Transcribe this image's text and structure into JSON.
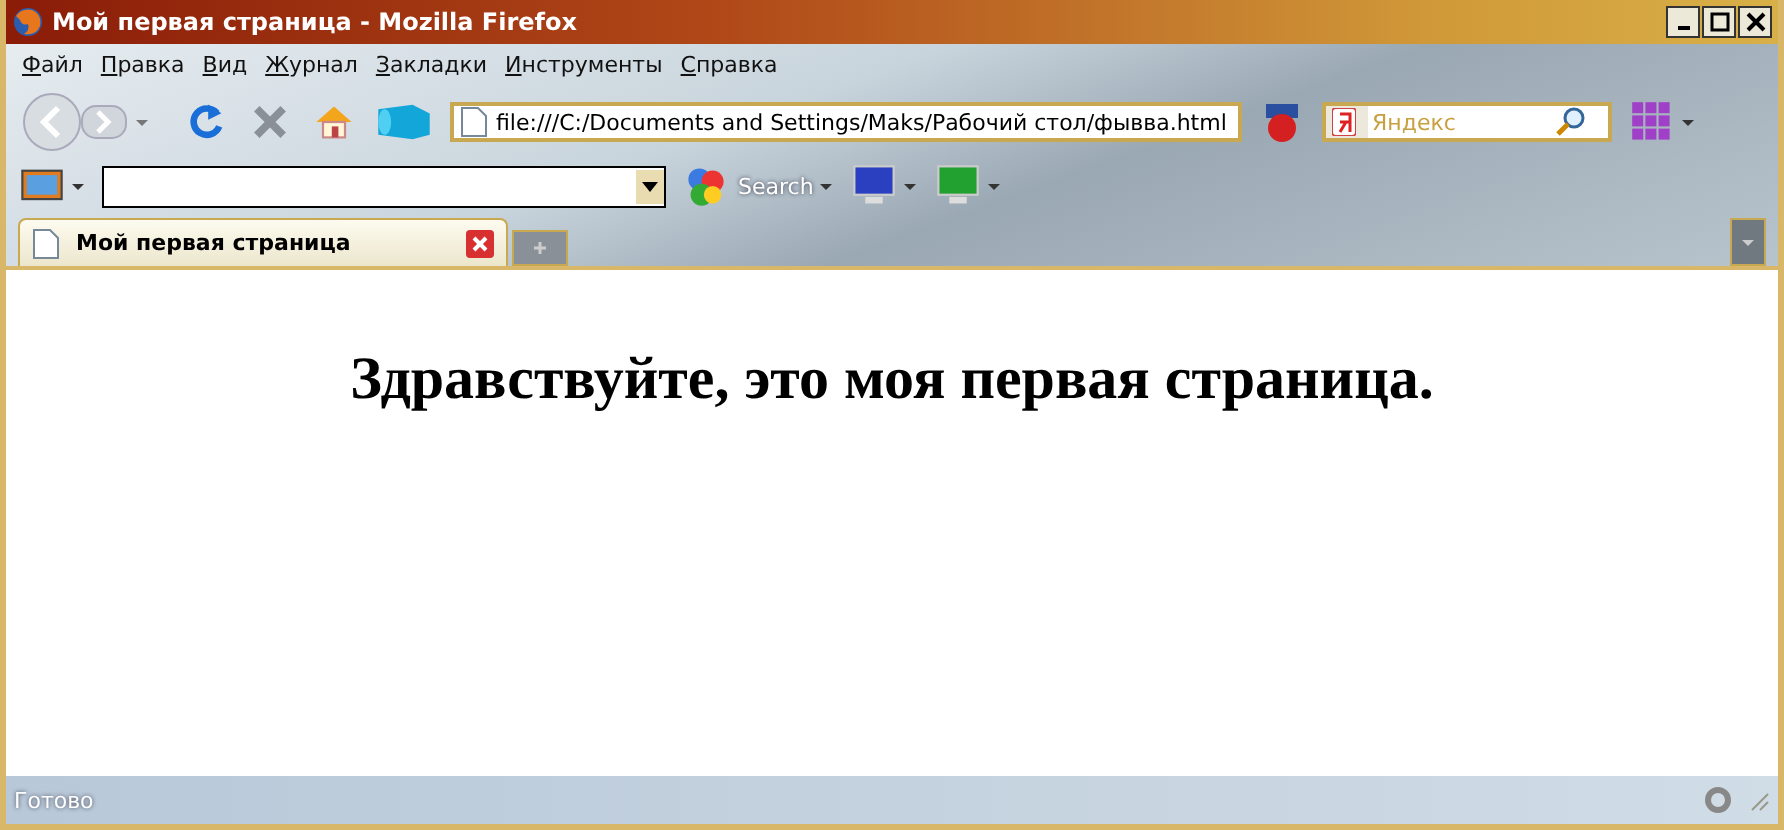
{
  "window": {
    "title": "Мой первая страница - Mozilla Firefox"
  },
  "menu": [
    "Файл",
    "Правка",
    "Вид",
    "Журнал",
    "Закладки",
    "Инструменты",
    "Справка"
  ],
  "navigation": {
    "url": "file:///C:/Documents and Settings/Maks/Рабочий стол/фывва.html",
    "search_placeholder": "Яндекс"
  },
  "toolbar": {
    "search_label": "Search"
  },
  "tabs": [
    {
      "label": "Мой первая страница",
      "selected": true
    }
  ],
  "page": {
    "heading": "Здравствуйте, это моя первая страница."
  },
  "status_bar": {
    "text": "Готово"
  }
}
